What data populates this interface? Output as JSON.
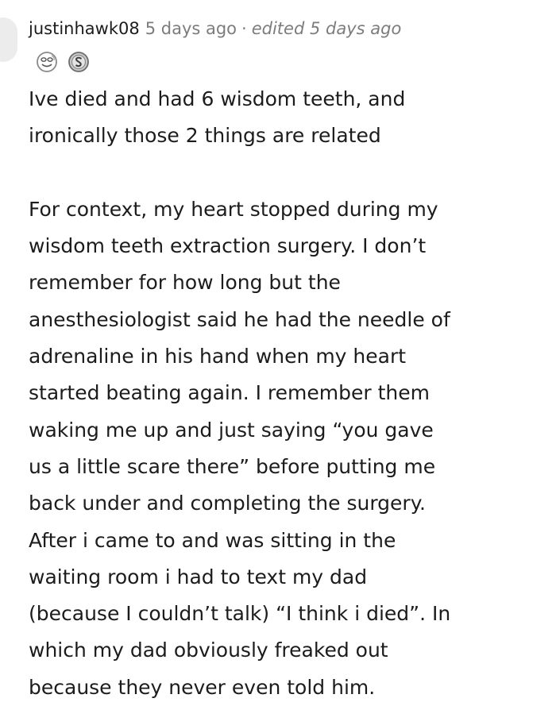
{
  "comment": {
    "author": "justinhawk08",
    "timestamp": "5 days ago",
    "separator": "·",
    "edited": "edited 5 days ago",
    "awards": [
      {
        "icon": "face-award-icon"
      },
      {
        "icon": "silver-coin-award-icon"
      }
    ],
    "paragraphs": [
      "Ive died and had 6 wisdom teeth, and\nironically those 2 things are related",
      "For context, my heart stopped during my\nwisdom teeth extraction surgery. I don’t\nremember for how long but the\nanesthesiologist said he had the needle of\nadrenaline in his hand when my heart\nstarted beating again. I remember them\nwaking me up and just saying “you gave\nus a little scare there” before putting me\nback under and completing the surgery.\nAfter i came to and was sitting in the\nwaiting room i had to text my dad\n(because I couldn’t talk) “I think i died”. In\nwhich my dad obviously freaked out\nbecause they never even told him."
    ]
  }
}
